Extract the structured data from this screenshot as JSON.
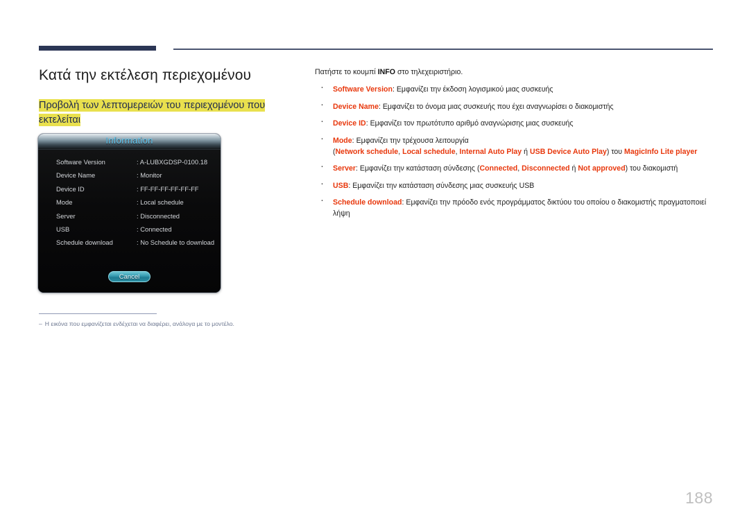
{
  "page": {
    "number": "188"
  },
  "left": {
    "title": "Κατά την εκτέλεση περιεχομένου",
    "subtitle": "Προβολή των λεπτομερειών του περιεχομένου που εκτελείται",
    "footnote_dash": "‒",
    "footnote_text": "Η εικόνα που εμφανίζεται ενδέχεται να διαφέρει, ανάλογα με το μοντέλο."
  },
  "dialog": {
    "title": "Information",
    "rows": [
      {
        "key": "Software Version",
        "value": ": A-LUBXGDSP-0100.18"
      },
      {
        "key": "Device Name",
        "value": ": Monitor"
      },
      {
        "key": "Device ID",
        "value": ": FF-FF-FF-FF-FF-FF"
      },
      {
        "key": "Mode",
        "value": ": Local schedule"
      },
      {
        "key": "Server",
        "value": ": Disconnected"
      },
      {
        "key": "USB",
        "value": ": Connected"
      },
      {
        "key": "Schedule download",
        "value": ": No Schedule to download"
      }
    ],
    "cancel_label": "Cancel"
  },
  "right": {
    "intro_before": "Πατήστε το κουμπί ",
    "intro_bold": "INFO",
    "intro_after": " στο τηλεχειριστήριο.",
    "bullets": [
      {
        "term": "Software Version",
        "sep": ": ",
        "text": "Εμφανίζει την έκδοση λογισμικού μιας συσκευής"
      },
      {
        "term": "Device Name",
        "sep": ": ",
        "text": "Εμφανίζει το όνομα μιας συσκευής που έχει αναγνωρίσει ο διακομιστής"
      },
      {
        "term": "Device ID",
        "sep": ": ",
        "text": "Εμφανίζει τον πρωτότυπο αριθμό αναγνώρισης μιας συσκευής"
      },
      {
        "term": "Mode",
        "sep": ": ",
        "text": "Εμφανίζει την τρέχουσα λειτουργία",
        "line2": {
          "open": "(",
          "opt1": "Network schedule",
          "c1": ", ",
          "opt2": "Local schedule",
          "c2": ", ",
          "opt3": "Internal Auto Play",
          "c3": " ή ",
          "opt4": "USB Device Auto Play",
          "close": ") του ",
          "opt5": "MagicInfo Lite player"
        }
      },
      {
        "term": "Server",
        "sep": ": ",
        "text_before": "Εμφανίζει την κατάσταση σύνδεσης (",
        "opt1": "Connected",
        "c1": ", ",
        "opt2": "Disconnected",
        "c2": " ή ",
        "opt3": "Not approved",
        "text_after": ") του διακομιστή"
      },
      {
        "term": "USB",
        "sep": ": ",
        "text": "Εμφανίζει την κατάσταση σύνδεσης μιας συσκευής USB"
      },
      {
        "term": "Schedule download",
        "sep": ": ",
        "text": "Εμφανίζει την πρόοδο ενός προγράμματος δικτύου του οποίου ο διακομιστής πραγματοποιεί λήψη"
      }
    ]
  },
  "colors": {
    "rule_dark": "#2b3655",
    "highlight_yellow": "#e9e04e",
    "term_red": "#e8380d",
    "osd_title_cyan": "#63c8f0",
    "footnote_blue": "#6c7790"
  }
}
